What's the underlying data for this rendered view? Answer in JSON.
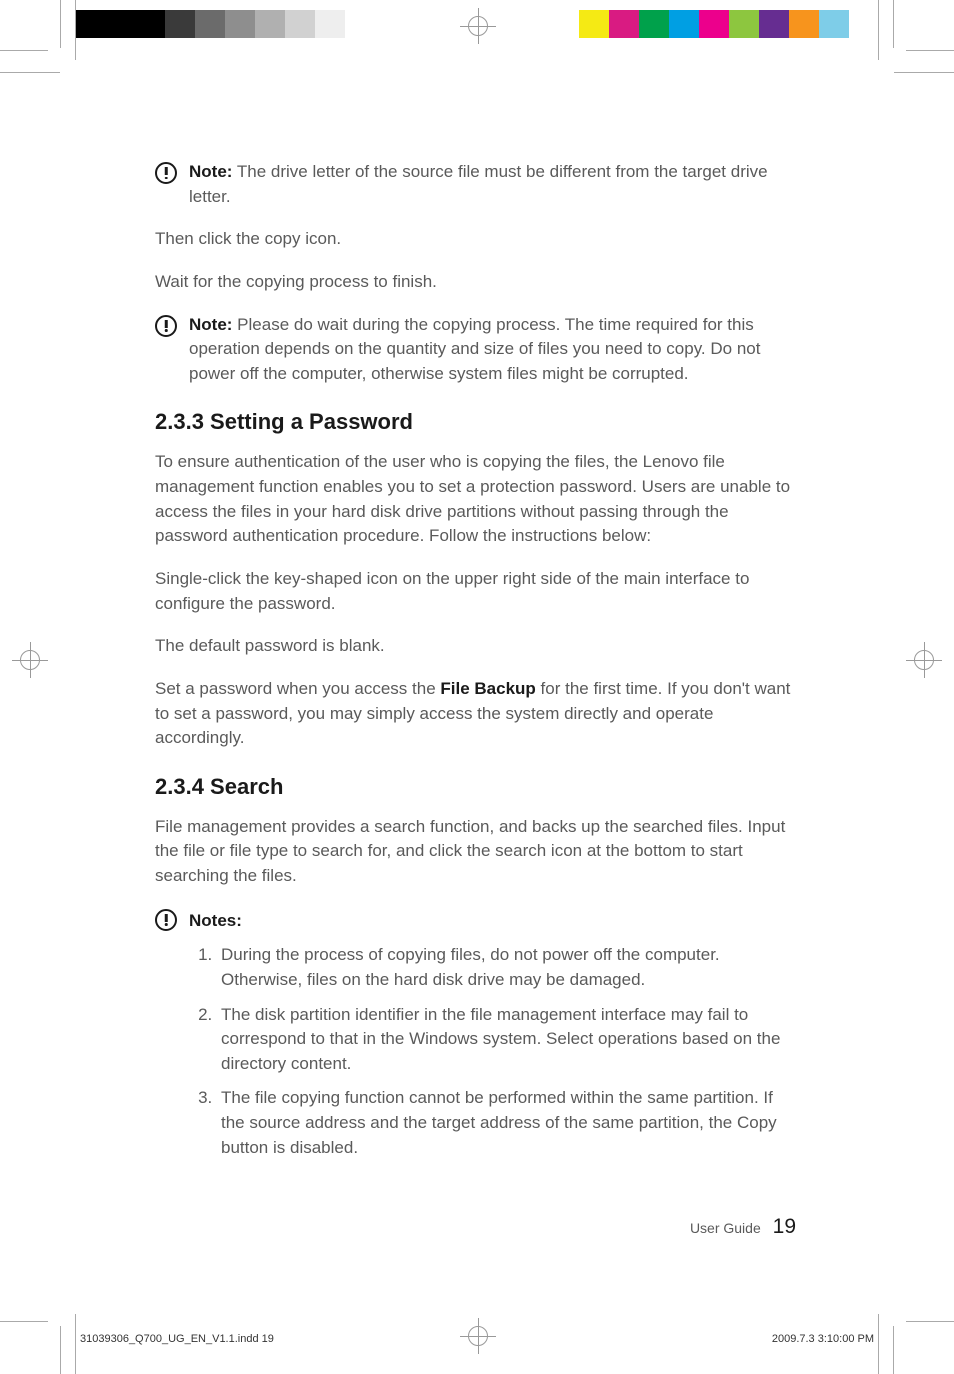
{
  "colorBars": {
    "left": [
      "#000000",
      "#000000",
      "#000000",
      "#3a3a3a",
      "#6b6b6b",
      "#8e8e8e",
      "#b0b0b0",
      "#d1d1d1",
      "#eeeeee",
      "#ffffff"
    ],
    "right": [
      "#f5ea14",
      "#d91b82",
      "#00a14b",
      "#009fe3",
      "#ec008c",
      "#8dc63f",
      "#662d91",
      "#f7941d",
      "#7ecde8",
      "#ffffff"
    ]
  },
  "note1": {
    "label": "Note:",
    "text": " The drive letter of the source file must be different from the target drive letter."
  },
  "para1": "Then click the copy icon.",
  "para2": "Wait for the copying process to finish.",
  "note2": {
    "label": "Note:",
    "text": " Please do wait during the copying process. The time required for this operation depends on the quantity and size of files you need to copy. Do not power off the computer, otherwise system files might be corrupted."
  },
  "sec233": {
    "heading": "2.3.3 Setting a Password",
    "p1": "To ensure authentication of the user who is copying the files, the Lenovo file management function enables you to set a protection password. Users are unable to access the files in your hard disk drive partitions without passing through the password authentication procedure. Follow the instructions below:",
    "p2": "Single-click the key-shaped icon on the upper right side of the main interface to configure the password.",
    "p3": "The default password is blank.",
    "p4a": "Set a password when you access the ",
    "p4bold": "File Backup",
    "p4b": " for the first time. If you don't want to set a password, you may simply access the system directly and operate accordingly."
  },
  "sec234": {
    "heading": "2.3.4 Search",
    "p1": "File management provides a search function, and backs up the searched files. Input the file or file type to search for, and click the search icon at the bottom to start searching the files."
  },
  "notesBlock": {
    "label": "Notes:",
    "items": [
      "During the process of copying files, do not power off the computer. Otherwise, files on the hard disk drive may be damaged.",
      "The disk partition identifier in the file management interface may fail to correspond to that in the Windows system. Select operations based on the directory content.",
      "The file copying function cannot be performed within the same partition. If the source address and the target address of the same partition, the Copy button is disabled."
    ]
  },
  "footer": {
    "label": "User Guide",
    "pageNum": "19"
  },
  "slug": {
    "left": "31039306_Q700_UG_EN_V1.1.indd   19",
    "right": "2009.7.3   3:10:00 PM"
  }
}
